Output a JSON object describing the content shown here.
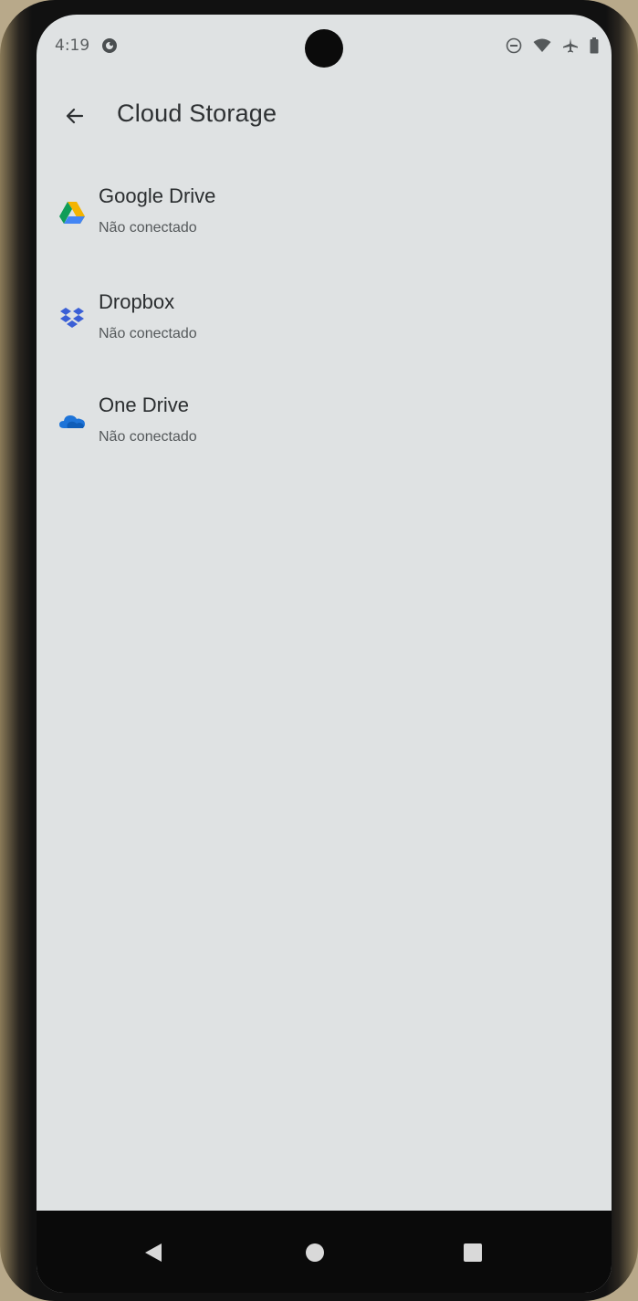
{
  "status_bar": {
    "time": "4:19",
    "icons": [
      "app-notification-icon",
      "do-not-disturb-icon",
      "wifi-icon",
      "airplane-icon",
      "battery-icon"
    ]
  },
  "header": {
    "back_icon": "arrow-left-icon",
    "title": "Cloud Storage"
  },
  "providers": [
    {
      "name": "Google Drive",
      "status": "Não conectado",
      "icon": "google-drive-icon"
    },
    {
      "name": "Dropbox",
      "status": "Não conectado",
      "icon": "dropbox-icon"
    },
    {
      "name": "One Drive",
      "status": "Não conectado",
      "icon": "onedrive-icon"
    }
  ],
  "nav_bar": {
    "buttons": [
      "back-triangle-icon",
      "home-circle-icon",
      "recents-square-icon"
    ]
  },
  "colors": {
    "background": "#dfe2e3",
    "text_primary": "#2a2d2f",
    "text_secondary": "#55595b",
    "nav_bar": "#0a0a0a"
  }
}
